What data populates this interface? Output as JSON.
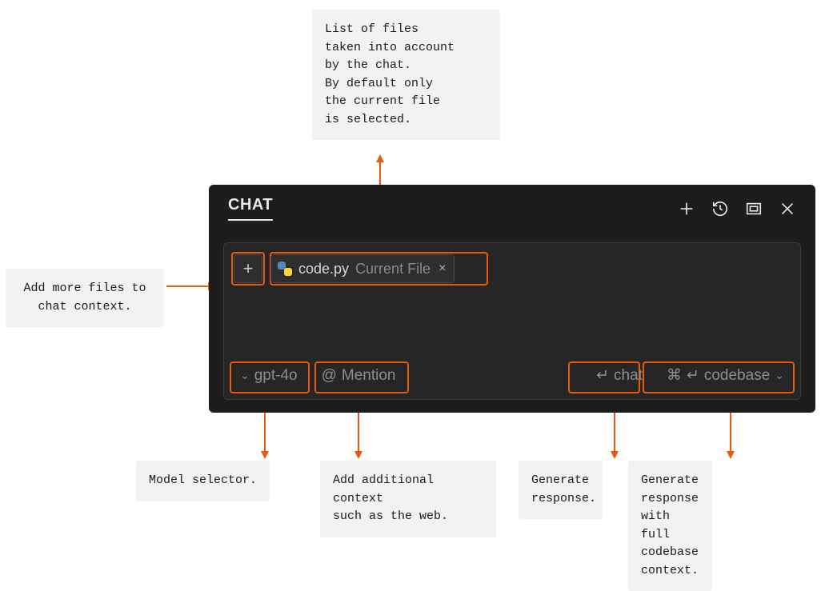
{
  "panel": {
    "title": "CHAT",
    "context": {
      "add_button_label": "+",
      "file": {
        "icon": "python-file-icon",
        "name": "code.py",
        "badge": "Current File",
        "close_label": "×"
      }
    },
    "bottom": {
      "model": {
        "chevron": "⌄",
        "label": "gpt-4o"
      },
      "mention": {
        "at": "@",
        "label": "Mention"
      },
      "chat": {
        "enter": "↵",
        "label": "chat"
      },
      "codebase": {
        "cmd": "⌘",
        "enter": "↵",
        "label": "codebase",
        "chevron": "⌄"
      }
    },
    "header_icons": {
      "plus": "plus-icon",
      "history": "history-icon",
      "layout": "layout-icon",
      "close": "close-icon"
    }
  },
  "callouts": {
    "files": "List of files\ntaken into account\nby the chat.\nBy default only\nthe current file\nis selected.",
    "add_context": "Add more files to\nchat context.",
    "model": "Model selector.",
    "mention": "Add additional context\nsuch as the web.",
    "chat": "Generate\nresponse.",
    "codebase": "Generate\nresponse\nwith full\ncodebase\ncontext."
  },
  "colors": {
    "accent": "#e8590c"
  }
}
